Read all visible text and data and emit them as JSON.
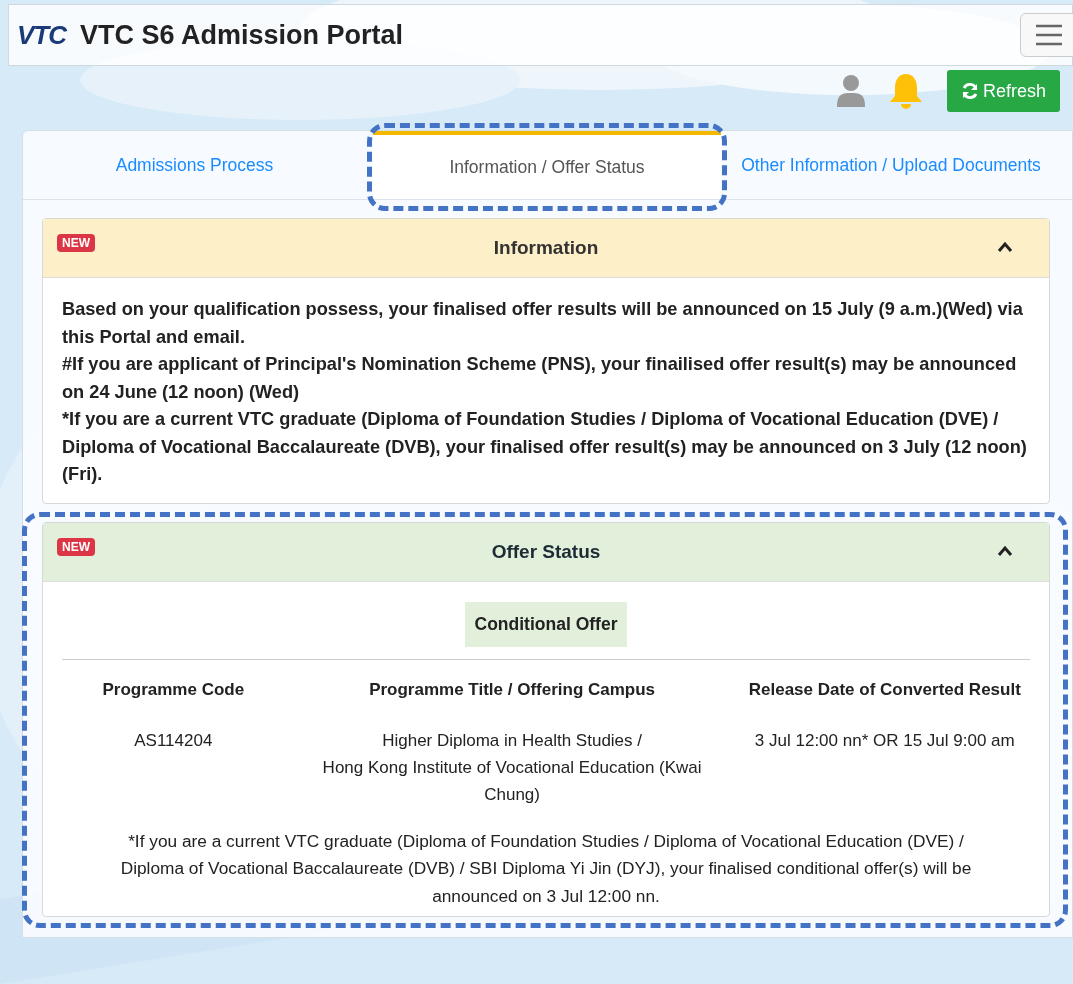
{
  "header": {
    "logo": "VTC",
    "title": "VTC S6 Admission Portal"
  },
  "toolbar": {
    "refresh_label": "Refresh"
  },
  "tabs": [
    {
      "label": "Admissions Process",
      "selected": false,
      "highlighted": false
    },
    {
      "label": "Information / Offer Status",
      "selected": true,
      "highlighted": true
    },
    {
      "label": "Other Information / Upload Documents",
      "selected": false,
      "highlighted": false
    }
  ],
  "information": {
    "badge": "NEW",
    "title": "Information",
    "expanded": true,
    "paragraphs": [
      "Based on your qualification possess, your finalised offer results will be announced on 15 July (9 a.m.)(Wed) via this Portal and email.",
      "#If you are applicant of Principal's Nomination Scheme (PNS), your finailised offer result(s) may be announced on 24 June (12 noon) (Wed)",
      "*If you are a current VTC graduate (Diploma of Foundation Studies / Diploma of Vocational Education (DVE) / Diploma of Vocational Baccalaureate (DVB), your finalised offer result(s) may be announced on 3 July (12 noon) (Fri)."
    ]
  },
  "offer_status": {
    "badge": "NEW",
    "title": "Offer Status",
    "expanded": true,
    "highlighted": true,
    "offer_type": "Conditional Offer",
    "table": {
      "columns": [
        "Programme Code",
        "Programme Title / Offering Campus",
        "Release Date of Converted Result"
      ],
      "rows": [
        [
          "AS114204",
          "Higher Diploma in Health Studies /\nHong Kong Institute of Vocational Education (Kwai Chung)",
          "3 Jul 12:00 nn* OR 15 Jul 9:00 am"
        ]
      ]
    },
    "note": "*If you are a current VTC graduate (Diploma of Foundation Studies / Diploma of Vocational Education (DVE) / Diploma of Vocational Baccalaureate (DVB) / SBI Diploma Yi Jin (DYJ), your finalised conditional offer(s) will be announced on 3 Jul 12:00 nn."
  }
}
